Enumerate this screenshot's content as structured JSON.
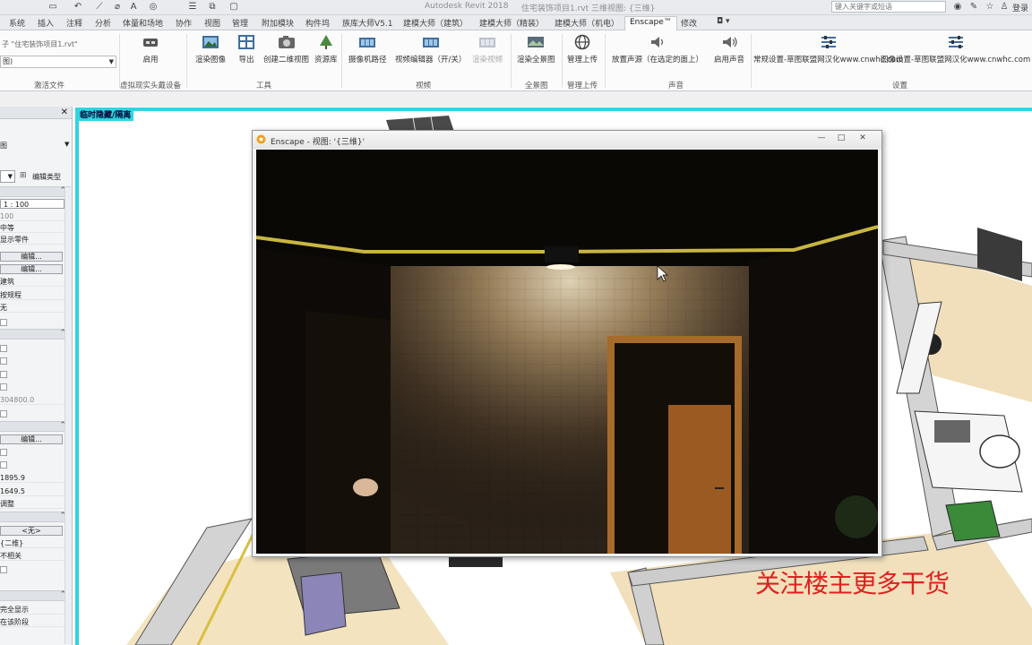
{
  "titlebar": {
    "app_title": "Autodesk Revit 2018",
    "file_title": "住宅装饰项目1.rvt",
    "view_title": "三维视图: {三维}",
    "search_placeholder": "键入关键字或短语",
    "sign_in": "登录"
  },
  "tabs": [
    "系统",
    "插入",
    "注释",
    "分析",
    "体量和场地",
    "协作",
    "视图",
    "管理",
    "附加模块",
    "构件坞",
    "族库大师V5.1",
    "建模大师（建筑）",
    "建模大师（精装）",
    "建模大师（机电）",
    "Enscape™",
    "修改",
    "◘ ▾"
  ],
  "active_tab": "Enscape™",
  "ribbon": {
    "file_combo_label": "子 \"住宅装饰项目1.rvt\"",
    "file_combo_value": "图)",
    "buttons": {
      "start": "启用",
      "render_image": "渲染图像",
      "export": "导出",
      "create_2d_view": "创建二维视图",
      "resource_lib": "资源库",
      "camera_path": "摄像机路径",
      "video_editor": "视频编辑器（开/关）",
      "render_video": "渲染视频",
      "render_panorama": "渲染全景图",
      "manage_upload": "管理上传",
      "play_sound": "放置声源（在选定的面上）",
      "enable_sound": "启用声音",
      "general_settings": "常规设置-草图联盟网汉化www.cnwhc.com",
      "image_settings": "图像设置-草图联盟网汉化www.cnwhc.com"
    },
    "panels": {
      "linked_files": "激活文件",
      "vr": "虚拟现实头戴设备",
      "tools": "工具",
      "video": "视频",
      "panorama": "全景图",
      "upload": "管理上传",
      "audio": "声音",
      "settings": "设置"
    }
  },
  "properties": {
    "type_label": "图",
    "edit_type": "编辑类型",
    "rows": [
      "1 : 100",
      "100",
      "中等",
      "显示零件",
      "编辑...",
      "编辑...",
      "建筑",
      "按规程",
      "无",
      "304800.0",
      "编辑...",
      "1895.9",
      "1649.5",
      "调整",
      "<无>",
      "{二维}",
      "不相关",
      "完全显示",
      "在该阶段"
    ]
  },
  "viewport": {
    "temp_hide_label": "临时隐藏/隔离"
  },
  "enscape": {
    "title": "Enscape - 视图: '{三维}'",
    "minimize": "—",
    "maximize": "□",
    "close": "✕"
  },
  "promo": "关注楼主更多干货",
  "colors": {
    "accent_cyan": "#2fd5e0",
    "promo_red": "#e02020",
    "ceiling_trim": "#c8b640"
  }
}
